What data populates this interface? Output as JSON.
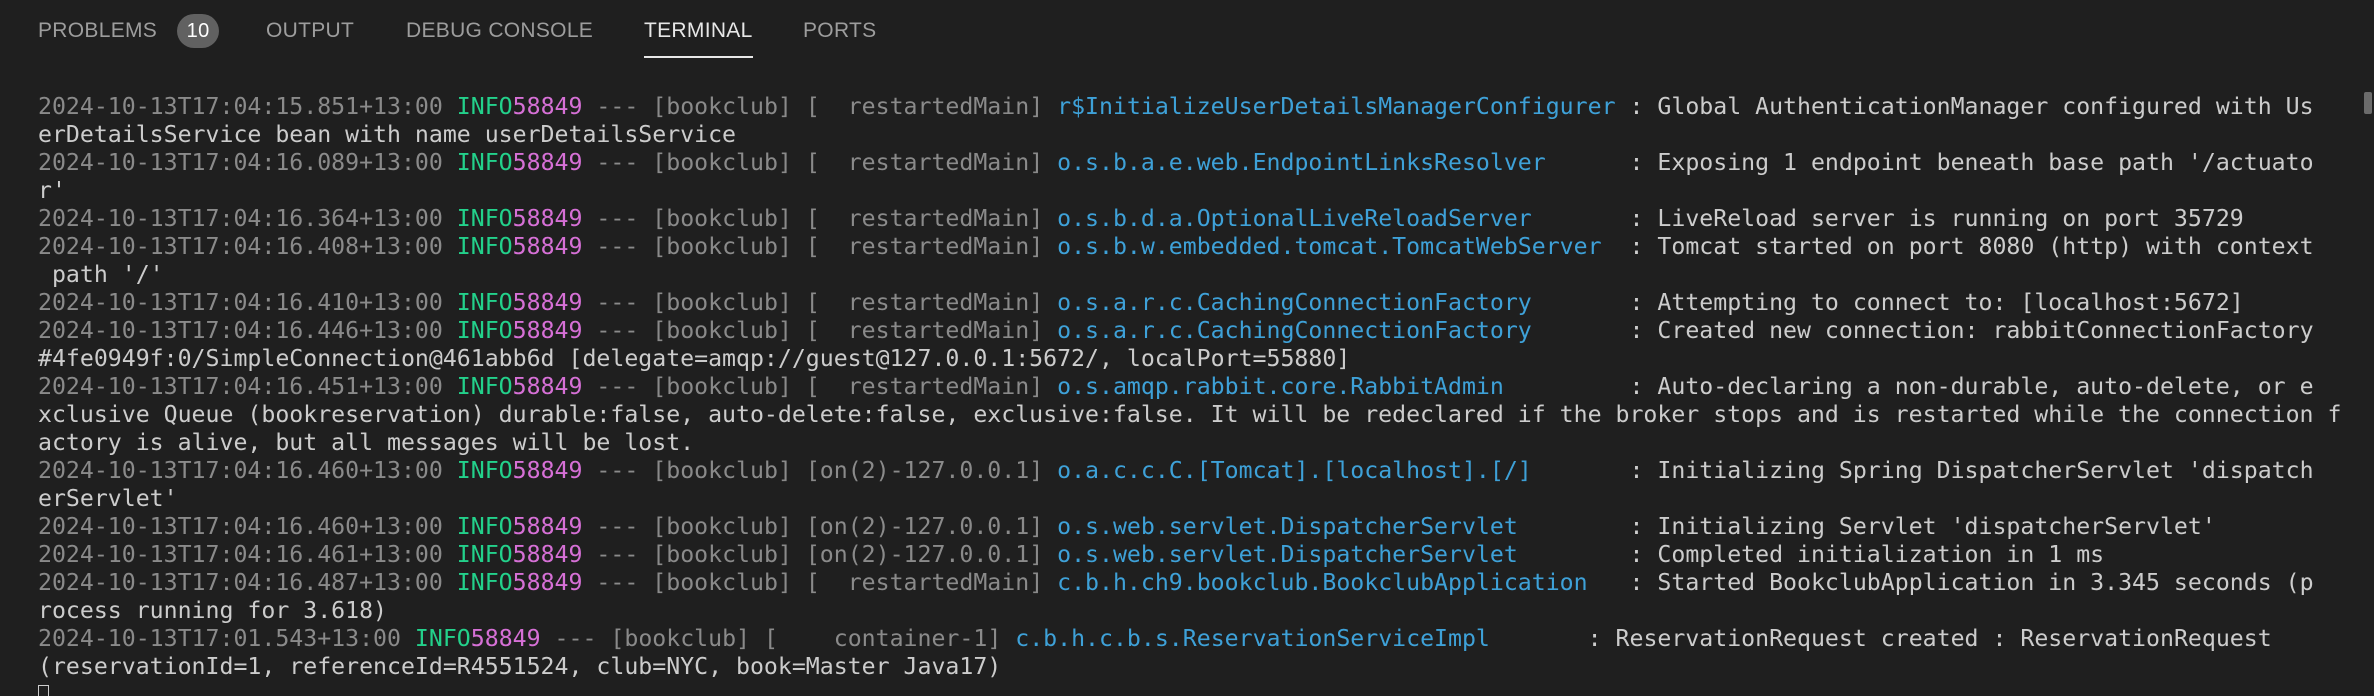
{
  "tabs": [
    {
      "label": "PROBLEMS",
      "badge": "10"
    },
    {
      "label": "OUTPUT"
    },
    {
      "label": "DEBUG CONSOLE"
    },
    {
      "label": "TERMINAL"
    },
    {
      "label": "PORTS"
    }
  ],
  "colors": {
    "background": "#1f1f1f",
    "timestamp": "#8a8a8a",
    "level": "#23d18b",
    "pid": "#d670d6",
    "logger": "#3ea1d8",
    "message": "#cccccc"
  },
  "logs": [
    {
      "ts": "2024-10-13T17:04:15.851+13:00",
      "level": " INFO",
      "pid": "58849",
      "mid": " --- [bookclub] [  restartedMain] ",
      "logger": "r$InitializeUserDetailsManagerConfigurer",
      "msg": " : Global AuthenticationManager configured with Us",
      "cont": [
        "erDetailsService bean with name userDetailsService"
      ]
    },
    {
      "ts": "2024-10-13T17:04:16.089+13:00",
      "level": " INFO",
      "pid": "58849",
      "mid": " --- [bookclub] [  restartedMain] ",
      "logger": "o.s.b.a.e.web.EndpointLinksResolver     ",
      "msg": " : Exposing 1 endpoint beneath base path '/actuato",
      "cont": [
        "r'"
      ]
    },
    {
      "ts": "2024-10-13T17:04:16.364+13:00",
      "level": " INFO",
      "pid": "58849",
      "mid": " --- [bookclub] [  restartedMain] ",
      "logger": "o.s.b.d.a.OptionalLiveReloadServer      ",
      "msg": " : LiveReload server is running on port 35729",
      "cont": []
    },
    {
      "ts": "2024-10-13T17:04:16.408+13:00",
      "level": " INFO",
      "pid": "58849",
      "mid": " --- [bookclub] [  restartedMain] ",
      "logger": "o.s.b.w.embedded.tomcat.TomcatWebServer ",
      "msg": " : Tomcat started on port 8080 (http) with context",
      "cont": [
        " path '/'"
      ]
    },
    {
      "ts": "2024-10-13T17:04:16.410+13:00",
      "level": " INFO",
      "pid": "58849",
      "mid": " --- [bookclub] [  restartedMain] ",
      "logger": "o.s.a.r.c.CachingConnectionFactory      ",
      "msg": " : Attempting to connect to: [localhost:5672]",
      "cont": []
    },
    {
      "ts": "2024-10-13T17:04:16.446+13:00",
      "level": " INFO",
      "pid": "58849",
      "mid": " --- [bookclub] [  restartedMain] ",
      "logger": "o.s.a.r.c.CachingConnectionFactory      ",
      "msg": " : Created new connection: rabbitConnectionFactory",
      "cont": [
        "#4fe0949f:0/SimpleConnection@461abb6d [delegate=amqp://guest@127.0.0.1:5672/, localPort=55880]"
      ]
    },
    {
      "ts": "2024-10-13T17:04:16.451+13:00",
      "level": " INFO",
      "pid": "58849",
      "mid": " --- [bookclub] [  restartedMain] ",
      "logger": "o.s.amqp.rabbit.core.RabbitAdmin        ",
      "msg": " : Auto-declaring a non-durable, auto-delete, or e",
      "cont": [
        "xclusive Queue (bookreservation) durable:false, auto-delete:false, exclusive:false. It will be redeclared if the broker stops and is restarted while the connection f",
        "actory is alive, but all messages will be lost."
      ]
    },
    {
      "ts": "2024-10-13T17:04:16.460+13:00",
      "level": " INFO",
      "pid": "58849",
      "mid": " --- [bookclub] [on(2)-127.0.0.1] ",
      "logger": "o.a.c.c.C.[Tomcat].[localhost].[/]      ",
      "msg": " : Initializing Spring DispatcherServlet 'dispatch",
      "cont": [
        "erServlet'"
      ]
    },
    {
      "ts": "2024-10-13T17:04:16.460+13:00",
      "level": " INFO",
      "pid": "58849",
      "mid": " --- [bookclub] [on(2)-127.0.0.1] ",
      "logger": "o.s.web.servlet.DispatcherServlet       ",
      "msg": " : Initializing Servlet 'dispatcherServlet'",
      "cont": []
    },
    {
      "ts": "2024-10-13T17:04:16.461+13:00",
      "level": " INFO",
      "pid": "58849",
      "mid": " --- [bookclub] [on(2)-127.0.0.1] ",
      "logger": "o.s.web.servlet.DispatcherServlet       ",
      "msg": " : Completed initialization in 1 ms",
      "cont": []
    },
    {
      "ts": "2024-10-13T17:04:16.487+13:00",
      "level": " INFO",
      "pid": "58849",
      "mid": " --- [bookclub] [  restartedMain] ",
      "logger": "c.b.h.ch9.bookclub.BookclubApplication  ",
      "msg": " : Started BookclubApplication in 3.345 seconds (p",
      "cont": [
        "rocess running for 3.618)"
      ]
    },
    {
      "ts": "2024-10-13T17:01.543+13:00",
      "level": " INFO",
      "pid": "58849",
      "mid": " --- [bookclub] [    container-1] ",
      "logger": "c.b.h.c.b.s.ReservationServiceImpl      ",
      "msg": " : ReservationRequest created : ReservationRequest",
      "cont": [
        "(reservationId=1, referenceId=R4551524, club=NYC, book=Master Java17)"
      ]
    }
  ]
}
